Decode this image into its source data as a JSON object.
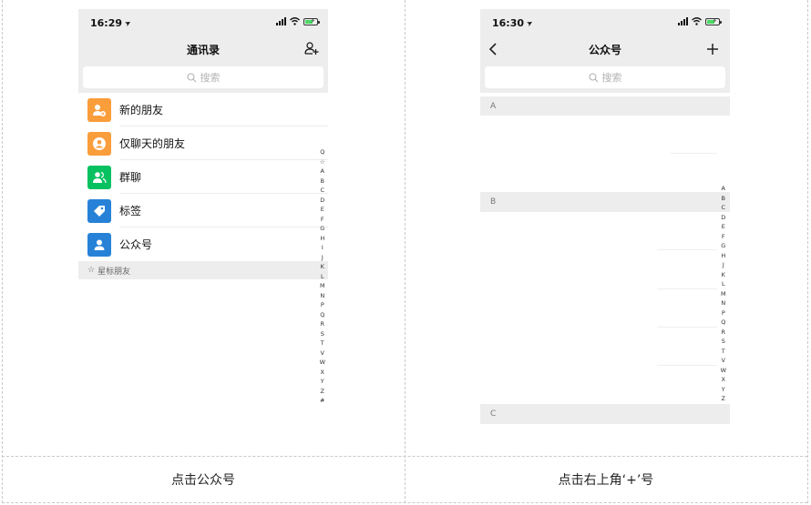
{
  "captions": {
    "left": "点击公众号",
    "right": "点击右上角‘+’号"
  },
  "left_phone": {
    "time": "16:29",
    "title": "通讯录",
    "search_placeholder": "搜索",
    "items": [
      {
        "label": "新的朋友",
        "icon": "add-friend-icon",
        "color": "#fa9d3b"
      },
      {
        "label": "仅聊天的朋友",
        "icon": "chat-only-friends-icon",
        "color": "#fa9d3b"
      },
      {
        "label": "群聊",
        "icon": "group-chat-icon",
        "color": "#07c160"
      },
      {
        "label": "标签",
        "icon": "tag-icon",
        "color": "#2782d7"
      },
      {
        "label": "公众号",
        "icon": "official-account-icon",
        "color": "#2782d7"
      }
    ],
    "section_label": "星标朋友",
    "index": [
      "Q",
      "☆",
      "A",
      "B",
      "C",
      "D",
      "E",
      "F",
      "G",
      "H",
      "I",
      "J",
      "K",
      "L",
      "M",
      "N",
      "P",
      "Q",
      "R",
      "S",
      "T",
      "V",
      "W",
      "X",
      "Y",
      "Z",
      "#"
    ]
  },
  "right_phone": {
    "time": "16:30",
    "title": "公众号",
    "search_placeholder": "搜索",
    "groups": [
      "A",
      "B",
      "C"
    ],
    "index": [
      "A",
      "B",
      "C",
      "D",
      "E",
      "F",
      "G",
      "H",
      "J",
      "K",
      "L",
      "M",
      "N",
      "P",
      "Q",
      "R",
      "S",
      "T",
      "V",
      "W",
      "X",
      "Y",
      "Z"
    ]
  }
}
